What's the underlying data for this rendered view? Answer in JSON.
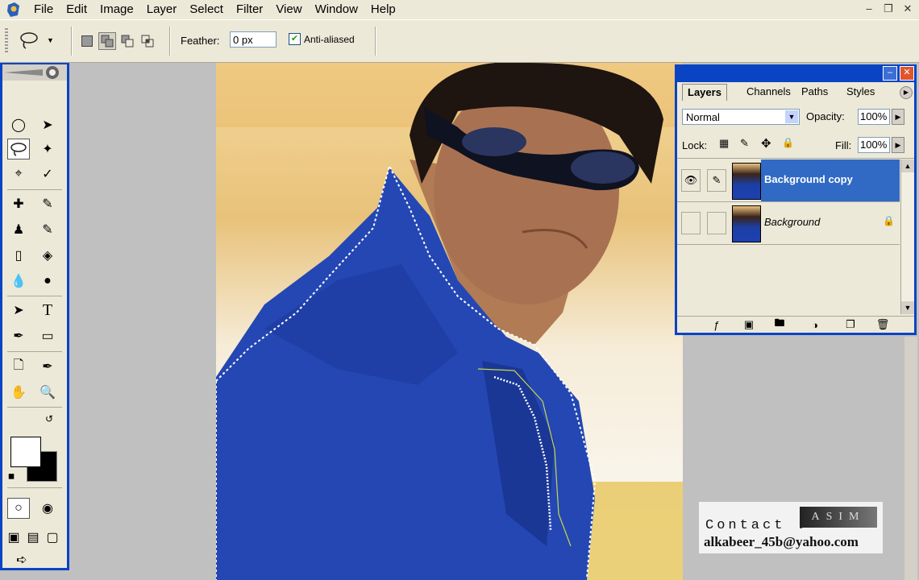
{
  "menu": {
    "items": [
      "File",
      "Edit",
      "Image",
      "Layer",
      "Select",
      "Filter",
      "View",
      "Window",
      "Help"
    ]
  },
  "options_bar": {
    "feather_label": "Feather:",
    "feather_value": "0 px",
    "anti_aliased_label": "Anti-aliased",
    "anti_aliased_checked": true
  },
  "layers_palette": {
    "tabs": [
      "Layers",
      "Channels",
      "Paths",
      "Styles"
    ],
    "active_tab": "Layers",
    "blend_mode": "Normal",
    "opacity_label": "Opacity:",
    "opacity_value": "100%",
    "lock_label": "Lock:",
    "fill_label": "Fill:",
    "fill_value": "100%",
    "layers": [
      {
        "name": "Background copy",
        "visible": true,
        "selected": true,
        "locked": false
      },
      {
        "name": "Background",
        "visible": false,
        "selected": false,
        "locked": true
      }
    ]
  },
  "watermark": {
    "contact_label": "Contact :",
    "brand": "ASIM",
    "email": "alkabeer_45b@yahoo.com"
  },
  "colors": {
    "palette_title_blue": "#0a44c4",
    "selected_layer": "#316ac5",
    "foreground": "#ffffff",
    "background": "#000000"
  },
  "active_tool": "lasso-tool"
}
